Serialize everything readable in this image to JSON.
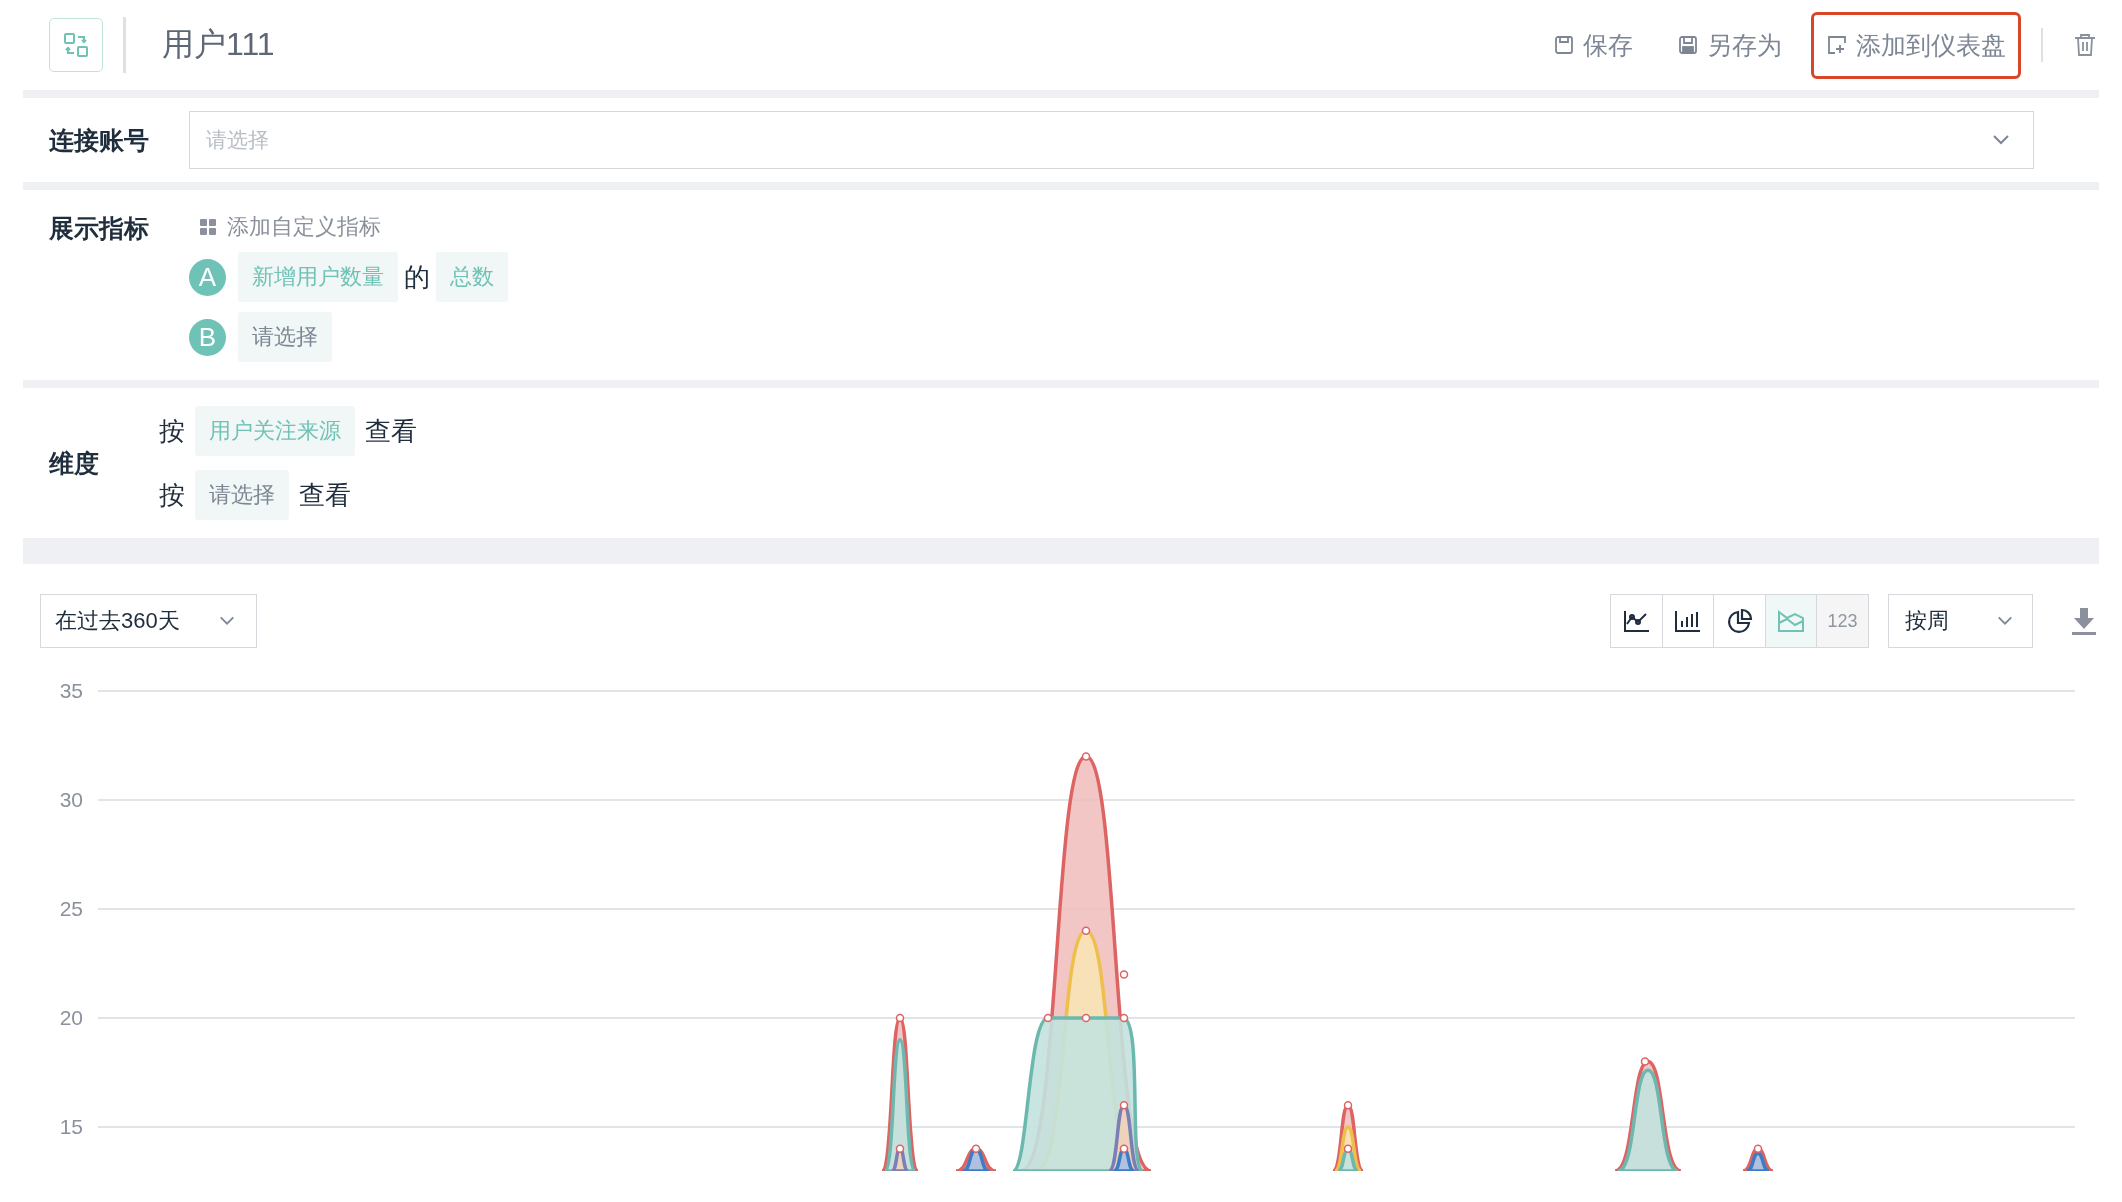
{
  "header": {
    "title": "用户111",
    "actions": [
      {
        "kind": "save",
        "label": "保存",
        "highlighted": false
      },
      {
        "kind": "saveas",
        "label": "另存为",
        "highlighted": false
      },
      {
        "kind": "dashboard",
        "label": "添加到仪表盘",
        "highlighted": true
      }
    ]
  },
  "account": {
    "label": "连接账号",
    "placeholder": "请选择"
  },
  "metrics": {
    "label": "展示指标",
    "add_link": "添加自定义指标",
    "items": [
      {
        "letter": "A",
        "field": "新增用户数量",
        "filled": true,
        "connector": "的",
        "aggregate": "总数"
      },
      {
        "letter": "B",
        "field": "请选择",
        "filled": false
      }
    ]
  },
  "dimensions": {
    "label": "维度",
    "rows": [
      {
        "prefix": "按",
        "value": "用户关注来源",
        "filled": true,
        "suffix": "查看"
      },
      {
        "prefix": "按",
        "value": "请选择",
        "filled": false,
        "suffix": "查看"
      }
    ]
  },
  "toolbar": {
    "range": "在过去360天",
    "chart_types": [
      {
        "kind": "line",
        "selected": false
      },
      {
        "kind": "bar",
        "selected": false
      },
      {
        "kind": "pie",
        "selected": false
      },
      {
        "kind": "area",
        "selected": true
      },
      {
        "kind": "number",
        "label": "123",
        "selected": false
      }
    ],
    "interval": "按周"
  },
  "chart": {
    "y_labels": [
      "35",
      "30",
      "25",
      "20",
      "15"
    ]
  }
}
